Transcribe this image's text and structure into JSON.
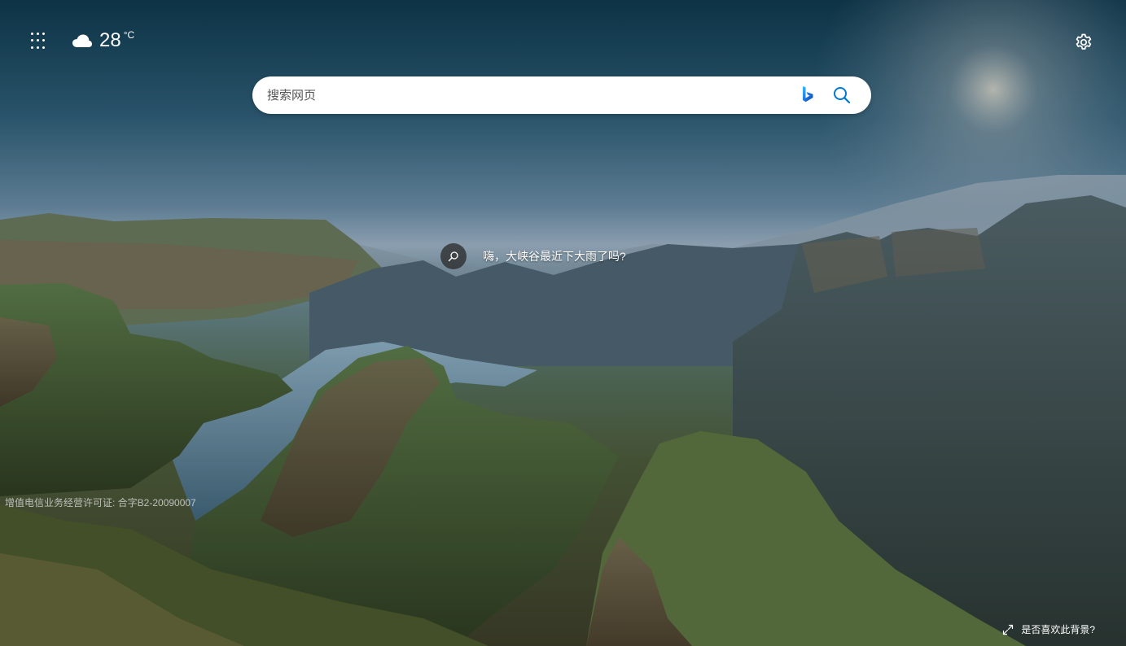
{
  "weather": {
    "temperature": "28",
    "unit": "°C",
    "icon": "cloud-icon"
  },
  "search": {
    "placeholder": "搜索网页"
  },
  "hint": {
    "text": "嗨，大峡谷最近下大雨了吗?"
  },
  "footer": {
    "license": "增值电信业务经营许可证: 合字B2-20090007",
    "like_background": "是否喜欢此背景?"
  },
  "icons": {
    "apps": "apps-grid-icon",
    "settings": "gear-icon",
    "bing": "bing-logo-icon",
    "search": "search-icon",
    "hint": "search-magnifier-icon",
    "expand": "expand-icon"
  },
  "colors": {
    "search_icon": "#0078d4",
    "search_box": "#ffffff",
    "text_light": "#ffffff"
  }
}
